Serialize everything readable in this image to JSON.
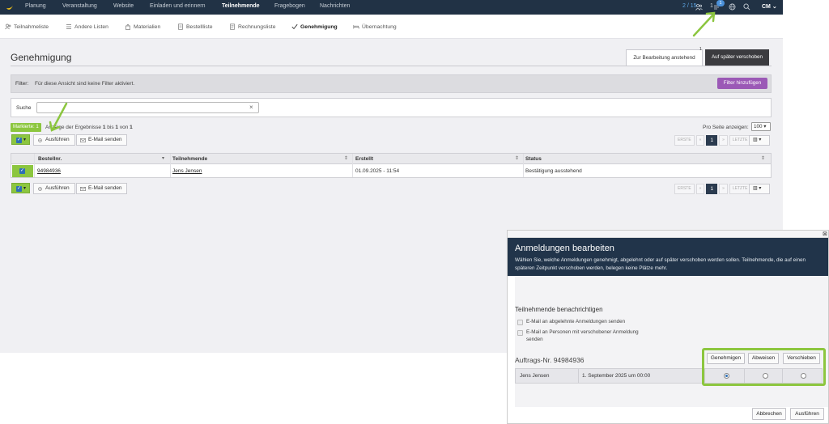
{
  "topnav": {
    "items": [
      "Planung",
      "Veranstaltung",
      "Website",
      "Einladen und erinnern",
      "Teilnehmende",
      "Fragebogen",
      "Nachrichten"
    ],
    "active": "Teilnehmende",
    "participants_count": "2 / 15",
    "cart_count": "1",
    "cart_badge": "1",
    "user_initials": "CM"
  },
  "subnav": {
    "items": [
      "Teilnahmeliste",
      "Andere Listen",
      "Materialien",
      "Bestellliste",
      "Rechnungsliste",
      "Genehmigung",
      "Übernachtung"
    ],
    "active": "Genehmigung"
  },
  "page": {
    "title": "Genehmigung",
    "tab_pending": "Zur Bearbeitung anstehend",
    "tab_pending_count": "1",
    "tab_postponed": "Auf später verschoben"
  },
  "filter": {
    "label": "Filter:",
    "text": "Für diese Ansicht sind keine Filter aktiviert.",
    "add_button": "Filter hinzufügen"
  },
  "search": {
    "label": "Suche",
    "value": "",
    "clear_icon": "×"
  },
  "results": {
    "marked_label": "Markierte: 1",
    "info_prefix": "Anzeige der Ergebnisse",
    "info_from": "1",
    "info_to_word": "bis",
    "info_to": "1",
    "info_of_word": "von",
    "info_total": "1",
    "per_page_label": "Pro Seite anzeigen:",
    "per_page_value": "100 ▾"
  },
  "actions": {
    "execute": "Ausführen",
    "email": "E-Mail senden"
  },
  "pager": {
    "first": "ERSTE",
    "prev": "«",
    "current": "1",
    "next": "»",
    "last": "LETZTE",
    "view_icon": "▥ ▾"
  },
  "table": {
    "columns": [
      "Bestellnr.",
      "Teilnehmende",
      "Erstellt",
      "Status"
    ],
    "rows": [
      {
        "order": "94984936",
        "participant": "Jens Jensen",
        "created": "01.09.2025 - 11:54",
        "status": "Bestätigung ausstehend"
      }
    ]
  },
  "modal": {
    "close_icon": "⊠",
    "title": "Anmeldungen bearbeiten",
    "description": "Wählen Sie, welche Anmeldungen genehmigt, abgelehnt oder auf später verschoben werden sollen. Teilnehmende, die auf einen späteren Zeitpunkt verschoben werden, belegen keine Plätze mehr.",
    "notify_title": "Teilnehmende benachrichtigen",
    "notify_rejected": "E-Mail an abgelehnte Anmeldungen senden",
    "notify_postponed": "E-Mail an Personen mit verschobener Anmeldung senden",
    "order_title": "Auftrags-Nr. 94984936",
    "btn_approve": "Genehmigen",
    "btn_reject": "Abweisen",
    "btn_postpone": "Verschieben",
    "row_name": "Jens Jensen",
    "row_date": "1. September 2025 um 00:00",
    "cancel": "Abbrechen",
    "execute": "Ausführen"
  },
  "colors": {
    "nav_bg": "#213245",
    "accent_green": "#8cc63f",
    "filter_button": "#9b59b6",
    "modal_header": "#21344a"
  }
}
